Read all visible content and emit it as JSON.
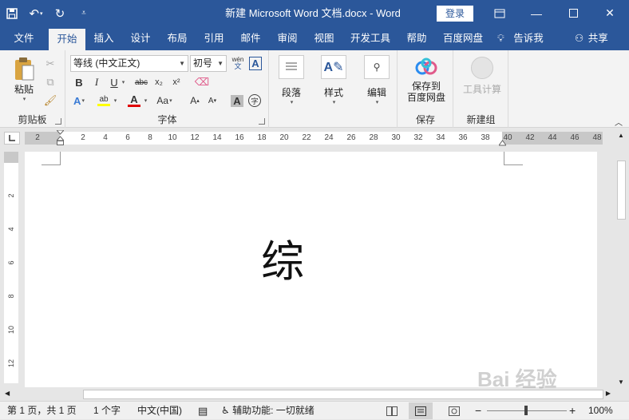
{
  "titlebar": {
    "doc_title": "新建 Microsoft Word 文档.docx  -  Word",
    "login": "登录"
  },
  "tabs": [
    {
      "label": "文件"
    },
    {
      "label": "开始"
    },
    {
      "label": "插入"
    },
    {
      "label": "设计"
    },
    {
      "label": "布局"
    },
    {
      "label": "引用"
    },
    {
      "label": "邮件"
    },
    {
      "label": "审阅"
    },
    {
      "label": "视图"
    },
    {
      "label": "开发工具"
    },
    {
      "label": "帮助"
    },
    {
      "label": "百度网盘"
    }
  ],
  "active_tab": "开始",
  "tell_me": "告诉我",
  "share": "共享",
  "ribbon": {
    "clipboard": {
      "paste": "粘贴",
      "label": "剪贴板"
    },
    "font": {
      "font_name": "等线 (中文正文)",
      "font_size": "初号",
      "label": "字体",
      "phonetic": "wén"
    },
    "paragraph": {
      "label": "段落"
    },
    "styles": {
      "label": "样式"
    },
    "editing": {
      "label": "编辑"
    },
    "save_baidu": {
      "label1": "保存到",
      "label2": "百度网盘",
      "group": "保存"
    },
    "new_group": {
      "label": "工具计算",
      "group": "新建组"
    }
  },
  "ruler": {
    "h_left": [
      "2"
    ],
    "h_ticks": [
      "2",
      "4",
      "6",
      "8",
      "10",
      "12",
      "14",
      "16",
      "18",
      "20",
      "22",
      "24",
      "26",
      "28",
      "30",
      "32",
      "34",
      "36",
      "38"
    ],
    "h_right": [
      "40",
      "42",
      "44",
      "46",
      "48"
    ],
    "v_ticks": [
      "2",
      "4",
      "6",
      "8",
      "10",
      "12"
    ]
  },
  "document": {
    "text": "综"
  },
  "statusbar": {
    "page": "第 1 页，共 1 页",
    "words": "1 个字",
    "lang": "中文(中国)",
    "accessibility": "辅助功能: 一切就绪",
    "zoom": "100%"
  },
  "watermark": "Bai 经验",
  "colors": {
    "brand": "#2b579a",
    "ribbon": "#f3f3f3",
    "highlight": "#ffff00",
    "font_red": "#e00000"
  }
}
